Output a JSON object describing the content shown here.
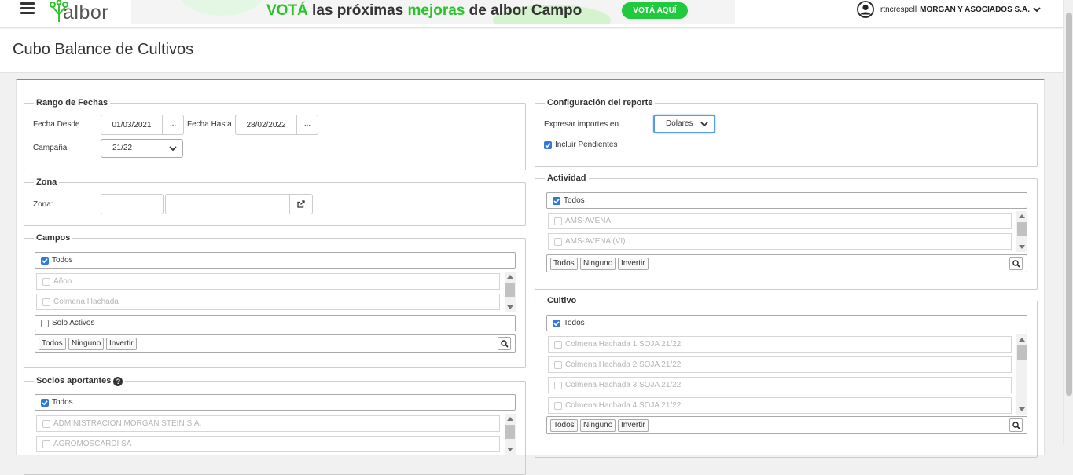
{
  "app": {
    "logo_text": "albor",
    "banner": {
      "word1": "VOTÁ",
      "word2": " las ",
      "word3": "próximas",
      "word4": " ",
      "word5": "mejoras",
      "word6": " de albor Campo",
      "button": "VOTÁ AQUÍ"
    },
    "user": {
      "username": "rtncrespell",
      "company": "MORGAN Y ASOCIADOS S.A."
    }
  },
  "page": {
    "title": "Cubo Balance de Cultivos"
  },
  "rango_fechas": {
    "legend": "Rango de Fechas",
    "desde_label": "Fecha Desde",
    "desde_value": "01/03/2021",
    "hasta_label": "Fecha Hasta",
    "hasta_value": "28/02/2022",
    "dots": "...",
    "campana_label": "Campaña",
    "campana_value": "21/22"
  },
  "zona": {
    "legend": "Zona",
    "label": "Zona:"
  },
  "campos": {
    "legend": "Campos",
    "todos": "Todos",
    "items": [
      "Añon",
      "Colmena Hachada"
    ],
    "solo_activos": "Solo Activos",
    "buttons": {
      "todos": "Todos",
      "ninguno": "Ninguno",
      "invertir": "Invertir"
    }
  },
  "socios": {
    "legend": "Socios aportantes",
    "help": "?",
    "todos": "Todos",
    "items": [
      "ADMINISTRACION MORGAN STEIN S.A.",
      "AGROMOSCARDI SA"
    ]
  },
  "config": {
    "legend": "Configuración del reporte",
    "importes_label": "Expresar importes en",
    "importes_value": "Dolares",
    "pendientes_label": "Incluir Pendientes"
  },
  "actividad": {
    "legend": "Actividad",
    "todos": "Todos",
    "items": [
      "AMS-AVENA",
      "AMS-AVENA (VI)"
    ],
    "buttons": {
      "todos": "Todos",
      "ninguno": "Ninguno",
      "invertir": "Invertir"
    }
  },
  "cultivo": {
    "legend": "Cultivo",
    "todos": "Todos",
    "items": [
      "Colmena Hachada 1 SOJA 21/22",
      "Colmena Hachada 2 SOJA 21/22",
      "Colmena Hachada 3 SOJA 21/22",
      "Colmena Hachada 4 SOJA 21/22"
    ],
    "buttons": {
      "todos": "Todos",
      "ninguno": "Ninguno",
      "invertir": "Invertir"
    }
  },
  "colors": {
    "accent_green": "#2ec52e",
    "checkbox_blue": "#2f7ad8",
    "focus_blue": "#5b9be0"
  },
  "icons": [
    "menu-icon",
    "albor-logo-icon",
    "user-avatar-icon",
    "chevron-down-icon",
    "external-link-icon",
    "search-icon",
    "help-icon",
    "checkmark-icon"
  ]
}
